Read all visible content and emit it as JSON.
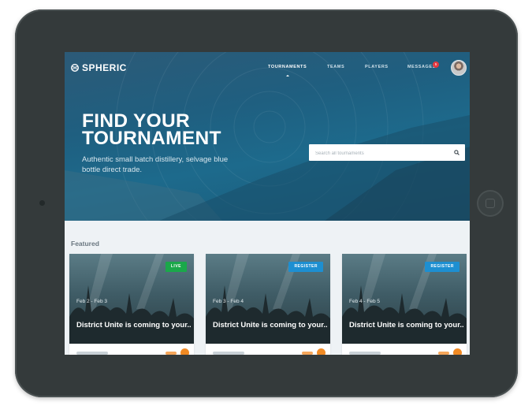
{
  "app": {
    "logo": "SPHERIC"
  },
  "nav": {
    "items": [
      {
        "label": "TOURNAMENTS",
        "active": true
      },
      {
        "label": "TEAMS",
        "active": false
      },
      {
        "label": "PLAYERS",
        "active": false
      },
      {
        "label": "MESSAGES",
        "active": false
      }
    ],
    "messages_badge": "5"
  },
  "hero": {
    "title_line1": "FIND YOUR",
    "title_line2": "TOURNAMENT",
    "subtitle": "Authentic small batch distillery, selvage blue bottle direct trade."
  },
  "search": {
    "placeholder": "Search all tournaments",
    "value": ""
  },
  "featured": {
    "heading": "Featured",
    "cards": [
      {
        "tag": "LIVE",
        "tag_color": "#1aa84a",
        "dates": "Feb 2 - Feb 3",
        "title": "District Unite is coming to your..."
      },
      {
        "tag": "REGISTER",
        "tag_color": "#1d8fd1",
        "dates": "Feb 3 - Feb 4",
        "title": "District Unite is coming to your..."
      },
      {
        "tag": "REGISTER",
        "tag_color": "#1d8fd1",
        "dates": "Feb 4 - Feb 5",
        "title": "District Unite is coming to your..."
      }
    ]
  },
  "colors": {
    "accent_orange": "#f08a24",
    "hero_blue": "#1f5f80",
    "badge_red": "#e2383f"
  },
  "icons": [
    "spheric-logo-icon",
    "search-icon",
    "avatar"
  ]
}
